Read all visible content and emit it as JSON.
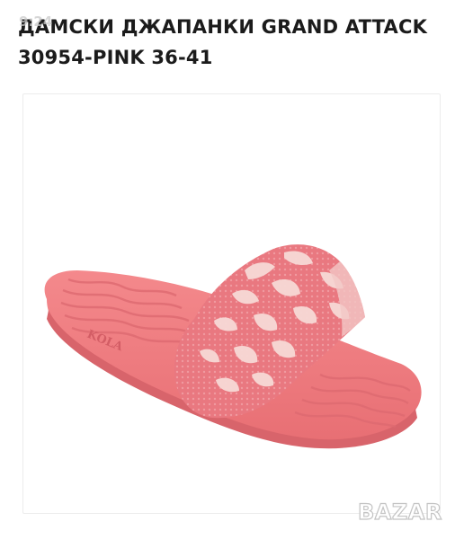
{
  "product": {
    "title": "ДАМСКИ ДЖАПАНКИ GRAND ATTACK 30954-PINK 36-41",
    "image": {
      "icon": "slipper-product-photo",
      "sole_color": "#f07e83",
      "strap_color": "#ea7c82",
      "pattern_color": "#f6d6d3",
      "brand_emboss": "KOLA"
    }
  },
  "overlay": {
    "time": "9:24"
  },
  "watermark": {
    "text": "BAZAR"
  }
}
